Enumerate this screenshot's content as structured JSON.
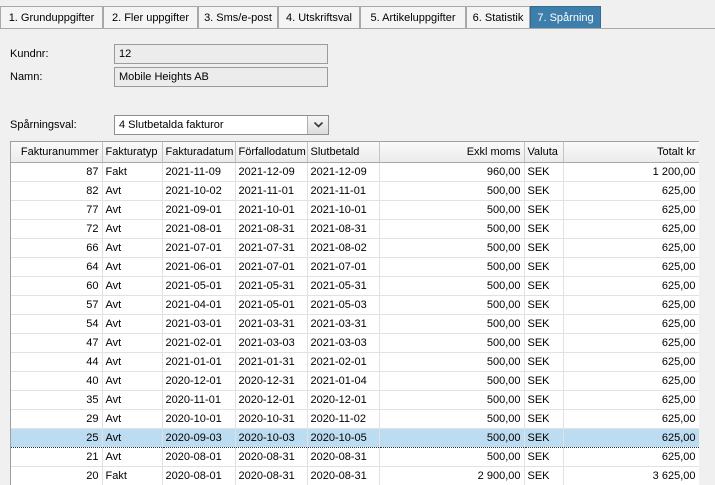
{
  "tabs": [
    {
      "label": "1. Grunduppgifter"
    },
    {
      "label": "2. Fler uppgifter"
    },
    {
      "label": "3. Sms/e-post"
    },
    {
      "label": "4. Utskriftsval"
    },
    {
      "label": "5. Artikeluppgifter"
    },
    {
      "label": "6. Statistik"
    },
    {
      "label": "7. Spårning"
    }
  ],
  "active_tab": "7. Spårning",
  "customer": {
    "kundnr_label": "Kundnr:",
    "kundnr_value": "12",
    "namn_label": "Namn:",
    "namn_value": "Mobile Heights AB"
  },
  "tracking": {
    "label": "Spårningsval:",
    "selected": "4 Slutbetalda fakturor"
  },
  "grid": {
    "columns": [
      "Fakturanummer",
      "Fakturatyp",
      "Fakturadatum",
      "Förfallodatum",
      "Slutbetald",
      "Exkl moms",
      "Valuta",
      "Totalt kr"
    ],
    "rows": [
      [
        "87",
        "Fakt",
        "2021-11-09",
        "2021-12-09",
        "2021-12-09",
        "960,00",
        "SEK",
        "1 200,00"
      ],
      [
        "82",
        "Avt",
        "2021-10-02",
        "2021-11-01",
        "2021-11-01",
        "500,00",
        "SEK",
        "625,00"
      ],
      [
        "77",
        "Avt",
        "2021-09-01",
        "2021-10-01",
        "2021-10-01",
        "500,00",
        "SEK",
        "625,00"
      ],
      [
        "72",
        "Avt",
        "2021-08-01",
        "2021-08-31",
        "2021-08-31",
        "500,00",
        "SEK",
        "625,00"
      ],
      [
        "66",
        "Avt",
        "2021-07-01",
        "2021-07-31",
        "2021-08-02",
        "500,00",
        "SEK",
        "625,00"
      ],
      [
        "64",
        "Avt",
        "2021-06-01",
        "2021-07-01",
        "2021-07-01",
        "500,00",
        "SEK",
        "625,00"
      ],
      [
        "60",
        "Avt",
        "2021-05-01",
        "2021-05-31",
        "2021-05-31",
        "500,00",
        "SEK",
        "625,00"
      ],
      [
        "57",
        "Avt",
        "2021-04-01",
        "2021-05-01",
        "2021-05-03",
        "500,00",
        "SEK",
        "625,00"
      ],
      [
        "54",
        "Avt",
        "2021-03-01",
        "2021-03-31",
        "2021-03-31",
        "500,00",
        "SEK",
        "625,00"
      ],
      [
        "47",
        "Avt",
        "2021-02-01",
        "2021-03-03",
        "2021-03-03",
        "500,00",
        "SEK",
        "625,00"
      ],
      [
        "44",
        "Avt",
        "2021-01-01",
        "2021-01-31",
        "2021-02-01",
        "500,00",
        "SEK",
        "625,00"
      ],
      [
        "40",
        "Avt",
        "2020-12-01",
        "2020-12-31",
        "2021-01-04",
        "500,00",
        "SEK",
        "625,00"
      ],
      [
        "35",
        "Avt",
        "2020-11-01",
        "2020-12-01",
        "2020-12-01",
        "500,00",
        "SEK",
        "625,00"
      ],
      [
        "29",
        "Avt",
        "2020-10-01",
        "2020-10-31",
        "2020-11-02",
        "500,00",
        "SEK",
        "625,00"
      ],
      [
        "25",
        "Avt",
        "2020-09-03",
        "2020-10-03",
        "2020-10-05",
        "500,00",
        "SEK",
        "625,00"
      ],
      [
        "21",
        "Avt",
        "2020-08-01",
        "2020-08-31",
        "2020-08-31",
        "500,00",
        "SEK",
        "625,00"
      ],
      [
        "20",
        "Fakt",
        "2020-08-01",
        "2020-08-31",
        "2020-08-31",
        "2 900,00",
        "SEK",
        "3 625,00"
      ]
    ],
    "selected_row_fakturanummer": "25"
  },
  "colors": {
    "active_tab": "#3d7eaa",
    "selected_row": "#bcdcf2"
  },
  "icons": {
    "combo_button": "chevron-down-icon"
  }
}
